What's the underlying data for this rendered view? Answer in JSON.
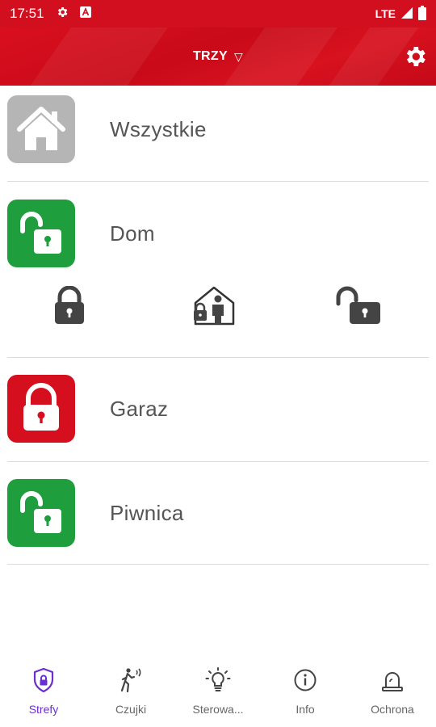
{
  "status_bar": {
    "time": "17:51",
    "network": "LTE",
    "icons": [
      "gear-icon",
      "a-icon",
      "signal-icon",
      "battery-icon"
    ]
  },
  "header": {
    "title": "TRZY",
    "dropdown_glyph": "▽",
    "settings_icon": "gear-icon",
    "color": "#d10f1f"
  },
  "zones": [
    {
      "label": "Wszystkie",
      "icon": "house-icon",
      "state": "all",
      "color": "#b5b5b5"
    },
    {
      "label": "Dom",
      "icon": "unlocked-icon",
      "state": "disarmed",
      "color": "#1e9e3c"
    },
    {
      "label": "Garaz",
      "icon": "locked-icon",
      "state": "armed",
      "color": "#d60f1e"
    },
    {
      "label": "Piwnica",
      "icon": "unlocked-icon",
      "state": "disarmed",
      "color": "#1e9e3c"
    }
  ],
  "zone_actions": [
    {
      "icon": "lock-icon"
    },
    {
      "icon": "home-arm-icon"
    },
    {
      "icon": "unlock-icon"
    }
  ],
  "bottom_nav": {
    "active_color": "#6b2fd1",
    "items": [
      {
        "label": "Strefy",
        "icon": "shield-lock-icon",
        "active": true
      },
      {
        "label": "Czujki",
        "icon": "motion-sensor-icon",
        "active": false
      },
      {
        "label": "Sterowa...",
        "icon": "lightbulb-icon",
        "active": false
      },
      {
        "label": "Info",
        "icon": "info-icon",
        "active": false
      },
      {
        "label": "Ochrona",
        "icon": "siren-icon",
        "active": false
      }
    ]
  }
}
